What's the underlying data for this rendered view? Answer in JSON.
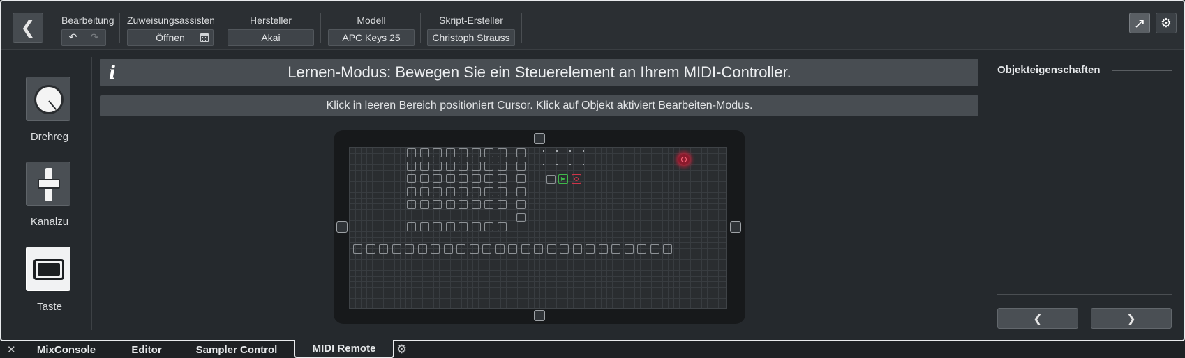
{
  "toolbar": {
    "back_icon": "❮",
    "edit_label": "Bearbeitungs:",
    "undo_icon": "↶",
    "redo_icon": "↷",
    "assistant_label": "Zuweisungsassistent",
    "assistant_button": "Öffnen",
    "vendor_label": "Hersteller",
    "vendor_value": "Akai",
    "model_label": "Modell",
    "model_value": "APC Keys 25",
    "author_label": "Skript-Ersteller",
    "author_value": "Christoph Strauss",
    "open_icon": "↗",
    "gear_icon": "⚙"
  },
  "palette": {
    "items": [
      {
        "label": "Drehreg",
        "icon": "knob-icon",
        "active": false
      },
      {
        "label": "Kanalzu",
        "icon": "fader-icon",
        "active": false
      },
      {
        "label": "Taste",
        "icon": "button-icon",
        "active": true
      }
    ]
  },
  "main": {
    "info_icon": "i",
    "learn_banner": "Lernen-Modus: Bewegen Sie ein Steuerelement an Ihrem MIDI-Controller.",
    "hint": "Klick in leeren Bereich positioniert Cursor. Klick auf Objekt aktiviert Bearbeiten-Modus."
  },
  "surface": {
    "pad_rows": 5,
    "pad_cols": 8,
    "bottom_buttons": 25,
    "colors": {
      "play": "#3fb94a",
      "record": "#d0354a",
      "knob_highlight": "#b4243a"
    }
  },
  "properties": {
    "title": "Objekteigenschaften",
    "prev_icon": "❮",
    "next_icon": "❯"
  },
  "tabs": {
    "close_icon": "✕",
    "items": [
      "MixConsole",
      "Editor",
      "Sampler Control",
      "MIDI Remote"
    ],
    "active": "MIDI Remote",
    "gear_icon": "⚙"
  }
}
